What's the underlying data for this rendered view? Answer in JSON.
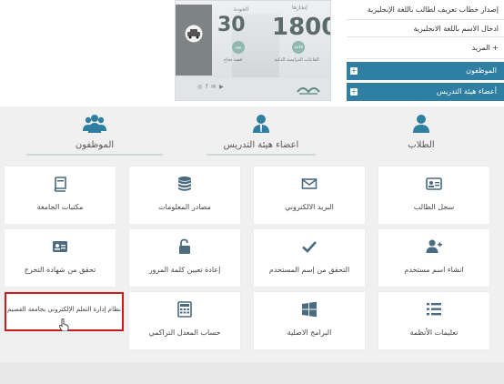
{
  "banner": {
    "card1_title": "إنجازها",
    "card1_number": "1800",
    "card1_badge": "قاعة",
    "card1_caption": "القاعات الدراسية الذكية",
    "card2_title": "الجودة",
    "card2_number": "30",
    "card2_badge": "يوم",
    "card2_caption": "قصة نجاح",
    "social": "◎ f ✉ ▶"
  },
  "right_menu": {
    "links": [
      "إصدار خطاب تعريف لطالب باللغة الإنجليزية",
      "ادخال الاسم باللغة الانجليزية",
      "+ المزيد"
    ],
    "bars": [
      {
        "label": "الموظفون"
      },
      {
        "label": "أعضاء هيئة التدريس"
      }
    ],
    "plus": "+"
  },
  "categories": [
    {
      "label": "الطلاب",
      "icon": "student-icon"
    },
    {
      "label": "اعضاء هيئة التدريس",
      "icon": "faculty-icon"
    },
    {
      "label": "الموظفون",
      "icon": "employees-icon"
    }
  ],
  "tiles": {
    "student_record": "سجل الطالب",
    "email": "البريد الالكتروني",
    "info_sources": "مصادر المعلومات",
    "libraries": "مكتبات الجامعة",
    "create_username": "انشاء اسم مستخدم",
    "verify_username": "التحقق من إسم المستخدم",
    "reset_password": "إعادة تعيين كلمة المرور",
    "verify_certificate": "تحقق من شهادة التخرج",
    "system_instructions": "تعليمات الأنظمة",
    "original_software": "البرامج الاصلية",
    "gpa_calculator": "حساب المعدل التراكمي",
    "lms": "نظام إدارة التعلم الإلكتروني بجامعة القصيم"
  },
  "colors": {
    "accent": "#2f7fa3",
    "highlight": "#c81d1d",
    "icon": "#4a6b80"
  }
}
